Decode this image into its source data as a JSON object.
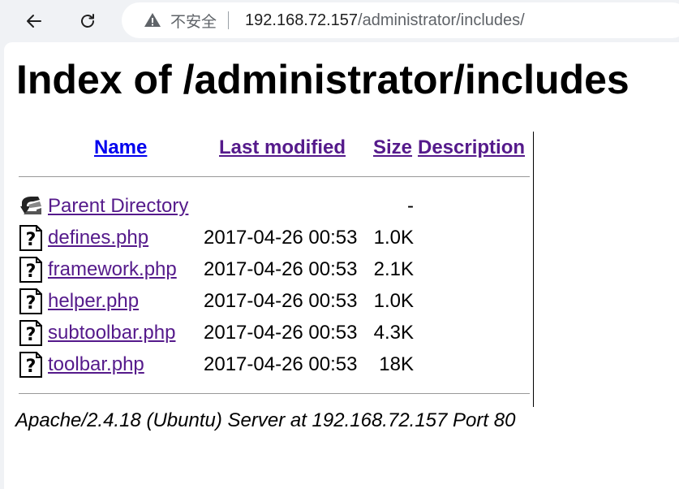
{
  "browser": {
    "security_label": "不安全",
    "url_host": "192.168.72.157",
    "url_path": "/administrator/includes/"
  },
  "page": {
    "title": "Index of /administrator/includes",
    "columns": {
      "name": "Name",
      "last_modified": "Last modified",
      "size": "Size",
      "description": "Description"
    },
    "parent": {
      "label": "Parent Directory",
      "size": "-"
    },
    "files": [
      {
        "name": "defines.php",
        "modified": "2017-04-26 00:53",
        "size": "1.0K"
      },
      {
        "name": "framework.php",
        "modified": "2017-04-26 00:53",
        "size": "2.1K"
      },
      {
        "name": "helper.php",
        "modified": "2017-04-26 00:53",
        "size": "1.0K"
      },
      {
        "name": "subtoolbar.php",
        "modified": "2017-04-26 00:53",
        "size": "4.3K"
      },
      {
        "name": "toolbar.php",
        "modified": "2017-04-26 00:53",
        "size": "18K"
      }
    ],
    "footer": "Apache/2.4.18 (Ubuntu) Server at 192.168.72.157 Port 80"
  },
  "colors": {
    "link_visited": "#551a8b",
    "link_unvisited": "#0000ee"
  }
}
